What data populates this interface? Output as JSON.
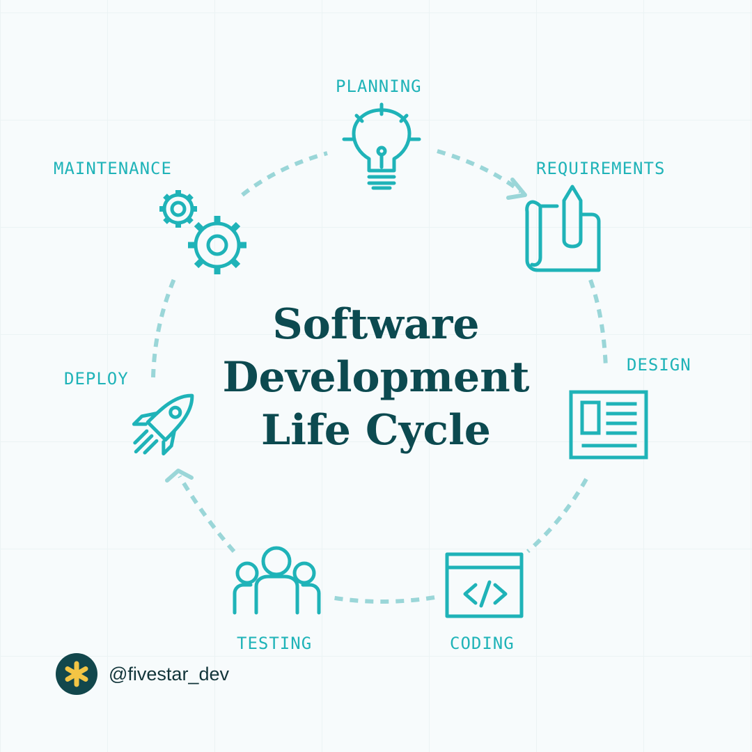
{
  "title": {
    "line1": "Software",
    "line2": "Development",
    "line3": "Life Cycle"
  },
  "stages": {
    "planning": "PLANNING",
    "requirements": "REQUIREMENTS",
    "design": "DESIGN",
    "coding": "CODING",
    "testing": "TESTING",
    "deploy": "DEPLOY",
    "maintenance": "MAINTENANCE"
  },
  "brand": {
    "handle": "@fivestar_dev"
  },
  "colors": {
    "accent": "#1fb3b8",
    "arrow": "#9ad6d8",
    "title": "#0c4a50",
    "brand_bg": "#12474c",
    "star": "#f3c545",
    "background": "#f7fbfc"
  },
  "icons": {
    "planning": "lightbulb-icon",
    "requirements": "scroll-pen-icon",
    "design": "layout-icon",
    "coding": "code-window-icon",
    "testing": "team-icon",
    "deploy": "rocket-icon",
    "maintenance": "gears-icon"
  }
}
